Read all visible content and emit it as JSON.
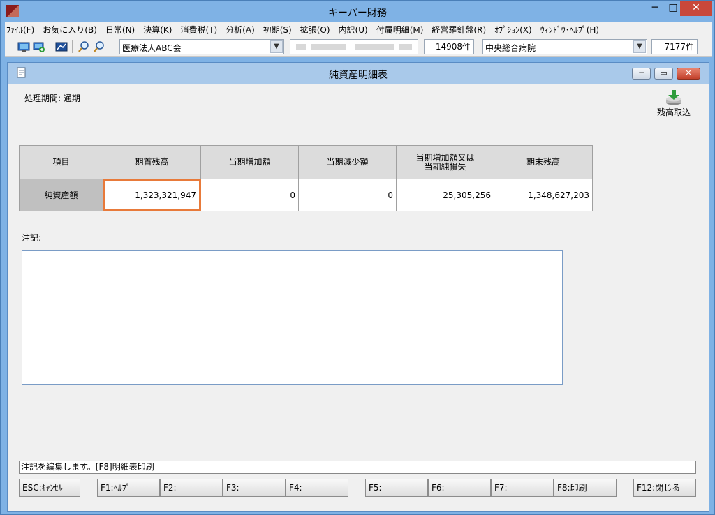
{
  "app": {
    "title": "キーパー財務",
    "minimize": "─",
    "maximize": "□",
    "close": "✕"
  },
  "menu": [
    "ﾌｧｲﾙ(F)",
    "お気に入り(B)",
    "日常(N)",
    "決算(K)",
    "消費税(T)",
    "分析(A)",
    "初期(S)",
    "拡張(O)",
    "内訳(U)",
    "付属明細(M)",
    "経営羅針盤(R)",
    "ｵﾌﾟｼｮﾝ(X)",
    "ｳｨﾝﾄﾞｳ･ﾍﾙﾌﾟ(H)"
  ],
  "toolbar": {
    "company": "医療法人ABC会",
    "company_count": "14908件",
    "facility": "中央総合病院",
    "facility_count": "7177件"
  },
  "window": {
    "title": "純資産明細表",
    "minimize": "─",
    "restore": "▭",
    "close": "✕"
  },
  "period_label": "処理期間: 通期",
  "import_label": "残高取込",
  "table": {
    "headers": [
      "項目",
      "期首残高",
      "当期増加額",
      "当期減少額",
      "当期増加額又は\n当期純損失",
      "期末残高"
    ],
    "row": {
      "label": "純資産額",
      "opening": "1,323,321,947",
      "increase": "0",
      "decrease": "0",
      "net": "25,305,256",
      "closing": "1,348,627,203"
    }
  },
  "note": {
    "label": "注記:",
    "value": ""
  },
  "status_text": "注記を編集します。[F8]明細表印刷",
  "fkeys": {
    "esc": "ESC:ｷｬﾝｾﾙ",
    "f1": "F1:ﾍﾙﾌﾟ",
    "f2": "F2:",
    "f3": "F3:",
    "f4": "F4:",
    "f5": "F5:",
    "f6": "F6:",
    "f7": "F7:",
    "f8": "F8:印刷",
    "f12": "F12:閉じる"
  }
}
